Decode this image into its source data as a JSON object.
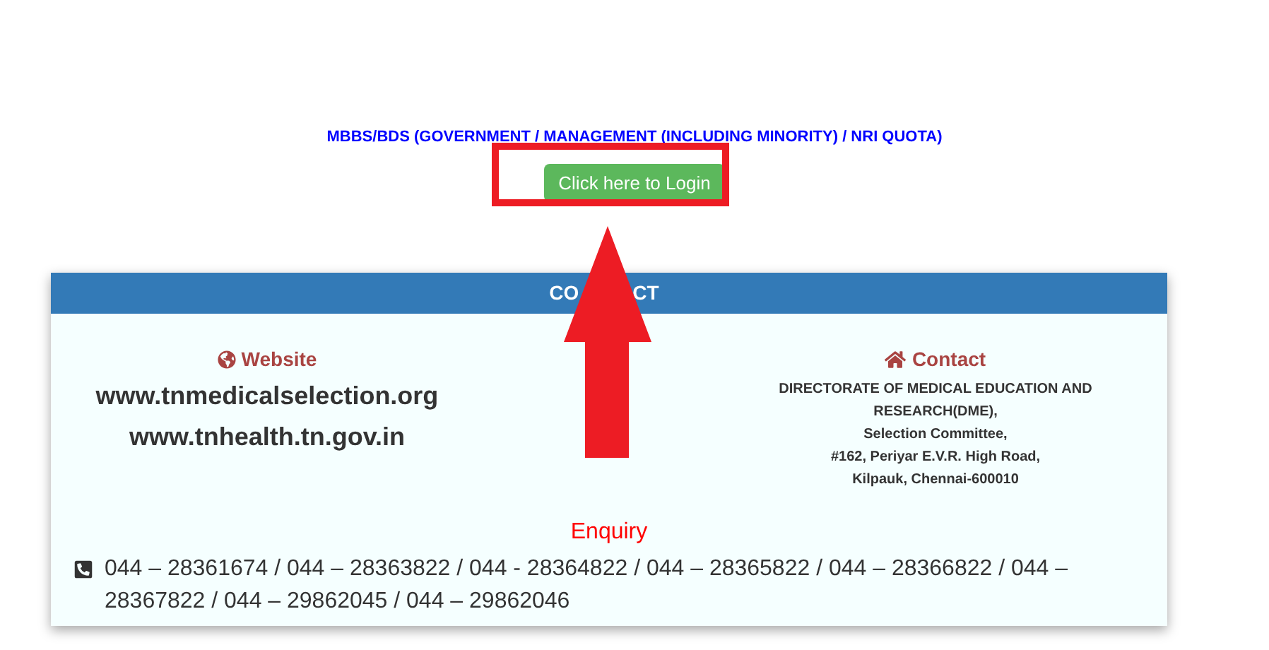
{
  "quota_title": "MBBS/BDS (GOVERNMENT / MANAGEMENT (INCLUDING MINORITY) / NRI QUOTA)",
  "login_button": "Click here to Login",
  "contact_panel": {
    "header_visible_parts": [
      "CO",
      "CT"
    ],
    "website": {
      "heading": "Website",
      "urls": [
        "www.tnmedicalselection.org",
        "www.tnhealth.tn.gov.in"
      ]
    },
    "contact": {
      "heading": "Contact",
      "lines": [
        "DIRECTORATE OF MEDICAL EDUCATION AND RESEARCH(DME),",
        "Selection Committee,",
        "#162, Periyar E.V.R. High Road,",
        "Kilpauk, Chennai-600010"
      ]
    },
    "enquiry": {
      "heading": "Enquiry",
      "phones": "044 – 28361674 / 044 – 28363822 / 044 - 28364822 / 044 – 28365822 / 044 – 28366822 / 044 – 28367822 / 044 – 29862045 / 044 – 29862046"
    }
  }
}
